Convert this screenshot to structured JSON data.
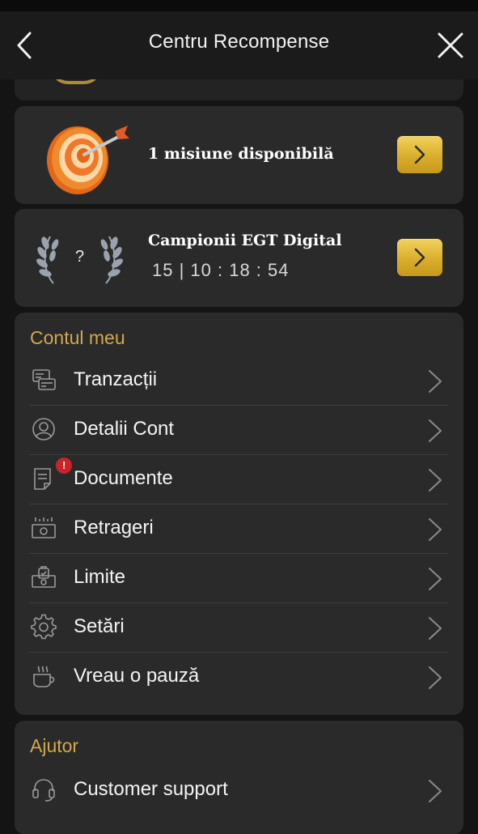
{
  "header": {
    "title": "Centru Recompense",
    "back_icon": "chevron-left-icon",
    "close_icon": "close-icon"
  },
  "mission_card": {
    "text": "1 misiune disponibilă",
    "icon": "dart-target-icon"
  },
  "champions_card": {
    "title": "Campionii EGT Digital",
    "rank_placeholder": "?",
    "timer": "15 | 10 : 18 : 54",
    "icon": "laurel-icon"
  },
  "account": {
    "title": "Contul meu",
    "items": [
      {
        "label": "Tranzacții",
        "icon": "transactions-icon"
      },
      {
        "label": "Detalii Cont",
        "icon": "user-icon"
      },
      {
        "label": "Documente",
        "icon": "document-icon",
        "alert_badge": "!"
      },
      {
        "label": "Retrageri",
        "icon": "withdraw-icon"
      },
      {
        "label": "Limite",
        "icon": "limits-icon"
      },
      {
        "label": "Setări",
        "icon": "gear-icon"
      },
      {
        "label": "Vreau o pauză",
        "icon": "coffee-icon"
      }
    ]
  },
  "help": {
    "title": "Ajutor",
    "items": [
      {
        "label": "Customer support",
        "icon": "headset-icon"
      }
    ]
  },
  "colors": {
    "background": "#141414",
    "card": "#2a2a2a",
    "accent_gold": "#d4a84a",
    "button_gold": "#e3bd3f",
    "badge_red": "#c8242b"
  }
}
